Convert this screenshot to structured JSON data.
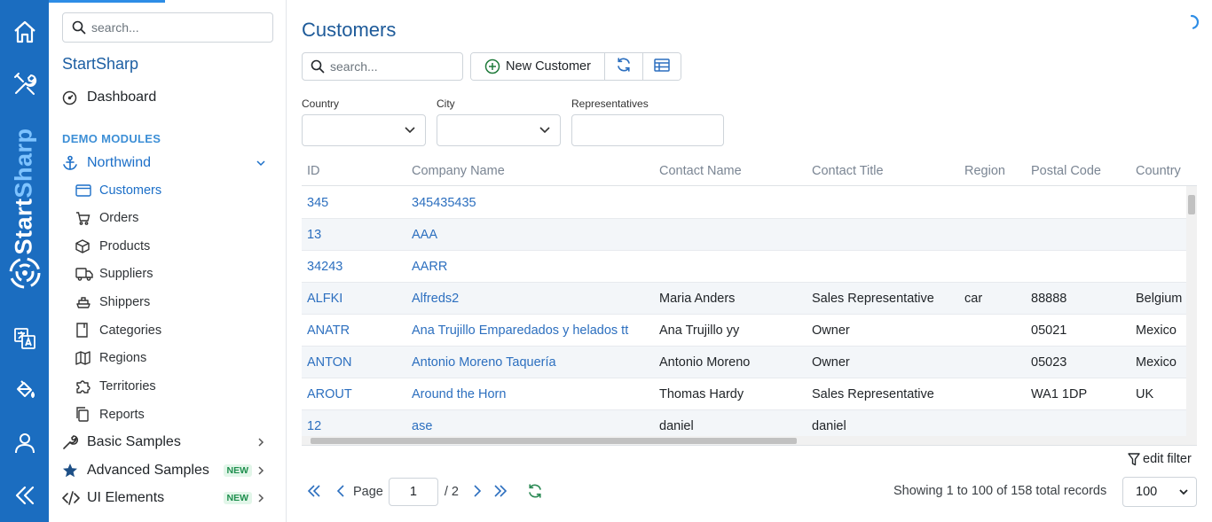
{
  "rail": {
    "brand_start": "Start",
    "brand_sharp": "Sharp",
    "icons": [
      "home-icon",
      "tools-icon",
      "translate-icon",
      "theme-icon",
      "user-icon",
      "collapse-icon"
    ]
  },
  "sidebar": {
    "search_placeholder": "search...",
    "title": "StartSharp",
    "dashboard": "Dashboard",
    "section": "DEMO MODULES",
    "northwind": "Northwind",
    "items": [
      {
        "label": "Customers",
        "icon": "card-icon",
        "active": true
      },
      {
        "label": "Orders",
        "icon": "cart-icon"
      },
      {
        "label": "Products",
        "icon": "cube-icon"
      },
      {
        "label": "Suppliers",
        "icon": "truck-icon"
      },
      {
        "label": "Shippers",
        "icon": "ship-icon"
      },
      {
        "label": "Categories",
        "icon": "folder-icon"
      },
      {
        "label": "Regions",
        "icon": "map-icon"
      },
      {
        "label": "Territories",
        "icon": "puzzle-icon"
      },
      {
        "label": "Reports",
        "icon": "copy-icon"
      }
    ],
    "basic_samples": "Basic Samples",
    "advanced_samples": "Advanced Samples",
    "ui_elements": "UI Elements",
    "badge_new": "NEW"
  },
  "main": {
    "title": "Customers",
    "search_placeholder": "search...",
    "new_customer": "New Customer",
    "filters": {
      "country_label": "Country",
      "city_label": "City",
      "representatives_label": "Representatives"
    },
    "columns": [
      "ID",
      "Company Name",
      "Contact Name",
      "Contact Title",
      "Region",
      "Postal Code",
      "Country"
    ],
    "rows": [
      [
        "345",
        "345435435",
        "",
        "",
        "",
        "",
        ""
      ],
      [
        "13",
        "AAA",
        "",
        "",
        "",
        "",
        ""
      ],
      [
        "34243",
        "AARR",
        "",
        "",
        "",
        "",
        ""
      ],
      [
        "ALFKI",
        "Alfreds2",
        "Maria Anders",
        "Sales Representative",
        "car",
        "88888",
        "Belgium"
      ],
      [
        "ANATR",
        "Ana Trujillo Emparedados y helados tt",
        "Ana Trujillo yy",
        "Owner",
        "",
        "05021",
        "Mexico"
      ],
      [
        "ANTON",
        "Antonio Moreno Taquería",
        "Antonio Moreno",
        "Owner",
        "",
        "05023",
        "Mexico"
      ],
      [
        "AROUT",
        "Around the Horn",
        "Thomas Hardy",
        "Sales Representative",
        "",
        "WA1 1DP",
        "UK"
      ],
      [
        "12",
        "ase",
        "daniel",
        "daniel",
        "",
        "",
        ""
      ]
    ],
    "edit_filter": "edit filter",
    "pager": {
      "page_label": "Page",
      "current_page": "1",
      "total_pages": "/ 2",
      "status": "Showing 1 to 100 of 158 total records",
      "page_size": "100"
    }
  }
}
